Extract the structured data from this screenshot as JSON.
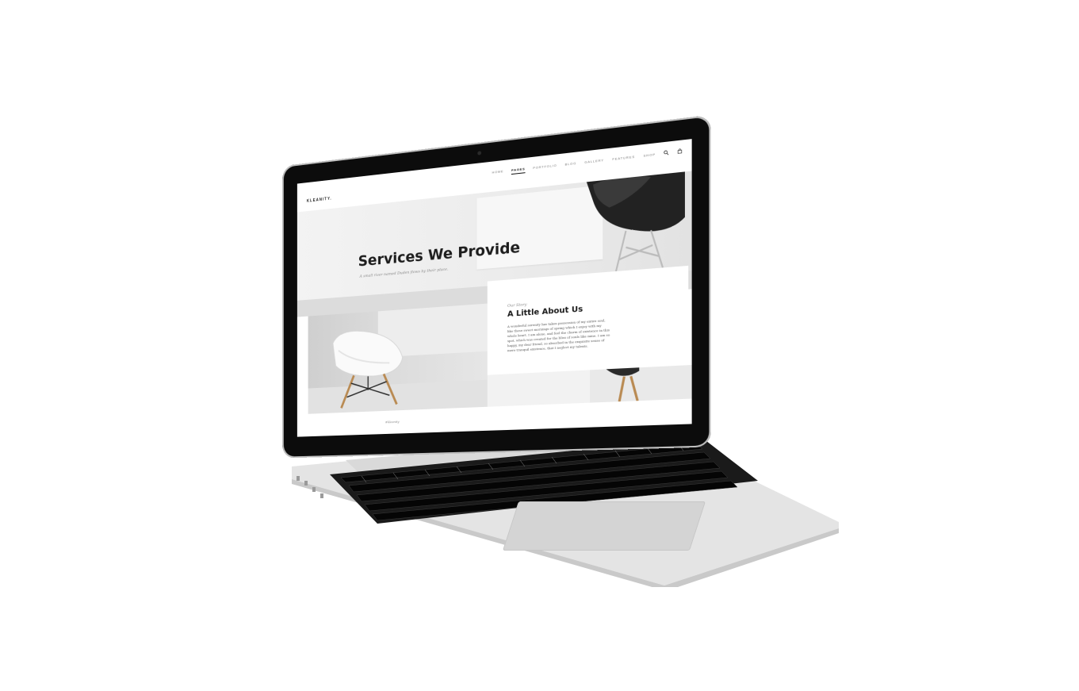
{
  "site": {
    "logo": "KLEANITY.",
    "nav": {
      "items": [
        {
          "label": "HOME",
          "active": false
        },
        {
          "label": "PAGES",
          "active": true
        },
        {
          "label": "PORTFOLIO",
          "active": false
        },
        {
          "label": "BLOG",
          "active": false
        },
        {
          "label": "GALLERY",
          "active": false
        },
        {
          "label": "FEATURES",
          "active": false
        },
        {
          "label": "SHOP",
          "active": false
        }
      ],
      "icons": [
        "search-icon",
        "cart-icon"
      ]
    },
    "hero": {
      "title": "Services We Provide",
      "subtitle": "A small river named Duden flows by their place."
    },
    "about": {
      "eyebrow": "Our Story",
      "title": "A Little About Us",
      "body": "A wonderful serenity has taken possession of my entire soul, like these sweet mornings of spring which I enjoy with my whole heart. I am alone, and feel the charm of existence in this spot, which was created for the bliss of souls like mine. I am so happy, my dear friend, so absorbed in the exquisite sense of mere tranquil existence, that I neglect my talents."
    },
    "footer": {
      "hashtag": "#kleanity"
    }
  },
  "colors": {
    "accent_dark": "#1d1d1d",
    "muted_text": "#8a8a8a",
    "laptop_silver": "#dcdcdc",
    "bezel": "#0c0c0c"
  }
}
